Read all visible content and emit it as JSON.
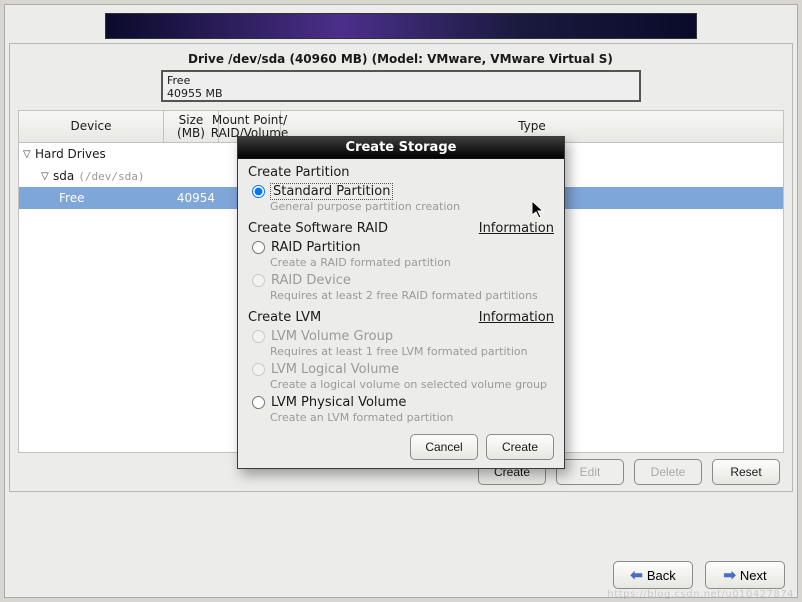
{
  "drive": {
    "title": "Drive /dev/sda (40960 MB) (Model: VMware, VMware Virtual S)",
    "box_line1": "Free",
    "box_line2": "40955 MB"
  },
  "table": {
    "headers": {
      "device": "Device",
      "size": "Size\n(MB)",
      "mount": "Mount Point/\nRAID/Volume",
      "type": "Type"
    },
    "rows": {
      "hd": "Hard Drives",
      "sda": "sda",
      "sda_path": "(/dev/sda)",
      "free": "Free",
      "free_size": "40954"
    }
  },
  "buttons": {
    "create": "Create",
    "edit": "Edit",
    "delete": "Delete",
    "reset": "Reset"
  },
  "nav": {
    "back": "Back",
    "next": "Next"
  },
  "dialog": {
    "title": "Create Storage",
    "s1": "Create Partition",
    "opt_std": "Standard Partition",
    "opt_std_desc": "General purpose partition creation",
    "s2": "Create Software RAID",
    "info": "Information",
    "opt_raid_part": "RAID Partition",
    "opt_raid_part_desc": "Create a RAID formated partition",
    "opt_raid_dev": "RAID Device",
    "opt_raid_dev_desc": "Requires at least 2 free RAID formated partitions",
    "s3": "Create LVM",
    "opt_lvm_vg": "LVM Volume Group",
    "opt_lvm_vg_desc": "Requires at least 1 free LVM formated partition",
    "opt_lvm_lv": "LVM Logical Volume",
    "opt_lvm_lv_desc": "Create a logical volume on selected volume group",
    "opt_lvm_pv": "LVM Physical Volume",
    "opt_lvm_pv_desc": "Create an LVM formated partition",
    "cancel": "Cancel",
    "create": "Create"
  },
  "watermark": "https://blog.csdn.net/u010427874"
}
